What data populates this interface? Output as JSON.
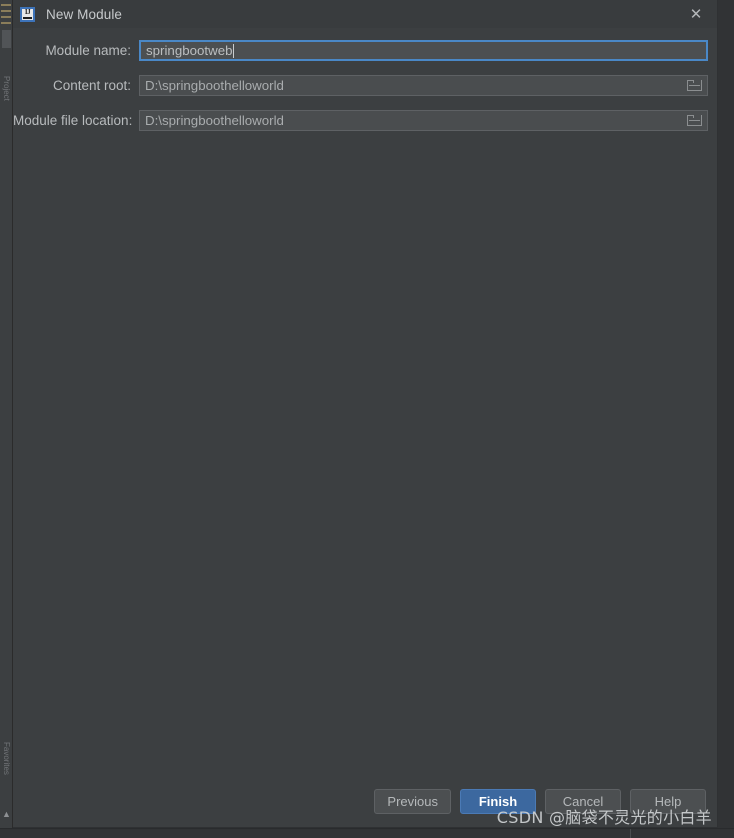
{
  "window": {
    "title": "New Module",
    "app_icon": "intellij-idea-icon",
    "close_icon": "close-icon",
    "accent_color": "#3c689f",
    "focus_border_color": "#4a88c7",
    "background_color": "#3c3f41",
    "titlebar_color": "#393c3e"
  },
  "form": {
    "fields": [
      {
        "label": "Module name:",
        "value": "springbootweb",
        "focused": true,
        "has_browse": false,
        "name": "module-name"
      },
      {
        "label": "Content root:",
        "value": "D:\\springboothelloworld",
        "focused": false,
        "has_browse": true,
        "name": "content-root"
      },
      {
        "label": "Module file location:",
        "value": "D:\\springboothelloworld",
        "focused": false,
        "has_browse": true,
        "name": "module-file-location"
      }
    ],
    "browse_icon": "folder-icon"
  },
  "footer": {
    "buttons": [
      {
        "label": "Previous",
        "default": false,
        "name": "previous-button"
      },
      {
        "label": "Finish",
        "default": true,
        "name": "finish-button"
      },
      {
        "label": "Cancel",
        "default": false,
        "name": "cancel-button"
      },
      {
        "label": "Help",
        "default": false,
        "name": "help-button"
      }
    ]
  },
  "watermark": {
    "text": "CSDN @脑袋不灵光的小白羊"
  },
  "ide_background": {
    "left_strip_label_top": "Project",
    "left_strip_label_bottom": "Favorites"
  }
}
